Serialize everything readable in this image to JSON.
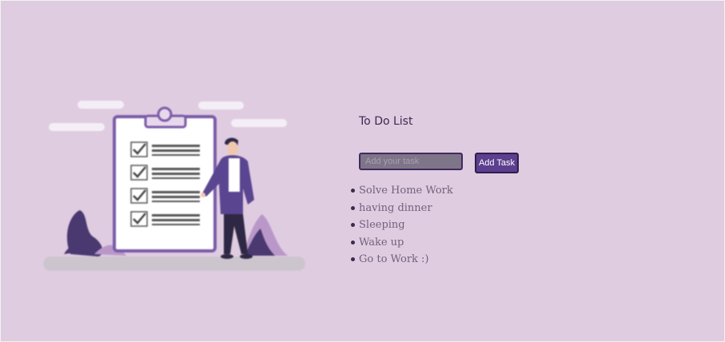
{
  "todo": {
    "title": "To Do List",
    "input": {
      "placeholder": "Add your task",
      "value": ""
    },
    "add_button_label": "Add Task",
    "tasks": [
      "Solve Home Work",
      "having dinner",
      "Sleeping",
      "Wake up",
      "Go to Work :)"
    ]
  },
  "illustration": {
    "icon": "clipboard-checklist-person-illustration",
    "colors": {
      "accent": "#7b5ca8",
      "dark": "#4a3870",
      "cloud": "#f4eef6",
      "ground": "#cdc5ce"
    }
  },
  "colors": {
    "background": "#e0cce1",
    "button": "#5c3f8f",
    "input": "#7f7589",
    "title": "#3b2a4f",
    "task_text": "#6f627c"
  }
}
